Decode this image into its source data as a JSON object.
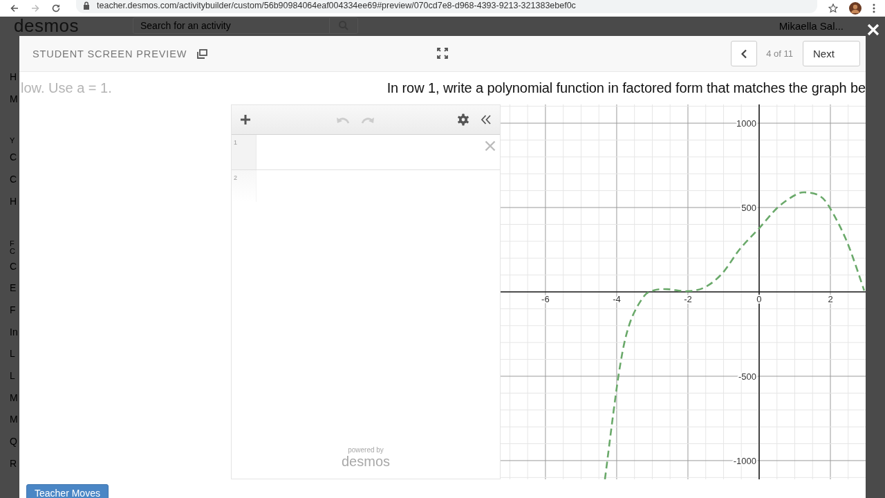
{
  "browser": {
    "url": "teacher.desmos.com/activitybuilder/custom/56b90984064eaf004334ee69#preview/070cd7e8-d968-4393-9213-321383ebef0c"
  },
  "background_page": {
    "logo": "desmos",
    "search": {
      "placeholder": "Search for an activity"
    },
    "user": "Mikaella Sal...",
    "sidebar_items": [
      {
        "label": "H",
        "kind": "item"
      },
      {
        "label": "M",
        "kind": "item"
      },
      {
        "label": "Y",
        "kind": "heading"
      },
      {
        "label": "C",
        "kind": "item"
      },
      {
        "label": "C",
        "kind": "item"
      },
      {
        "label": "H",
        "kind": "item"
      },
      {
        "label": "F",
        "kind": "heading"
      },
      {
        "label": "C",
        "kind": "subheading"
      },
      {
        "label": "C",
        "kind": "item"
      },
      {
        "label": "E",
        "kind": "item"
      },
      {
        "label": "F",
        "kind": "item"
      },
      {
        "label": "In",
        "kind": "item"
      },
      {
        "label": "L",
        "kind": "item"
      },
      {
        "label": "L",
        "kind": "item"
      },
      {
        "label": "M",
        "kind": "item"
      },
      {
        "label": "M",
        "kind": "item"
      },
      {
        "label": "Q",
        "kind": "item"
      },
      {
        "label": "R",
        "kind": "item"
      }
    ]
  },
  "modal": {
    "title": "STUDENT SCREEN PREVIEW",
    "pager": "4 of 11",
    "next_button": "Next",
    "prompt_faded": "low. Use a = 1.",
    "prompt": "In row 1, write a polynomial function in factored form that matches the graph be",
    "calculator": {
      "undo_enabled": false,
      "redo_enabled": false,
      "expressions": [
        {
          "number": "1",
          "selected": true
        },
        {
          "number": "2",
          "selected": false
        }
      ],
      "powered_by": "powered by",
      "brand": "desmos",
      "chart_data": {
        "type": "line",
        "x": [
          -4.33,
          -3.94,
          -3.65,
          -3.26,
          -2.97,
          -2.58,
          -2,
          -1.51,
          -1.03,
          -0.54,
          0,
          0.52,
          1.01,
          1.3,
          1.69,
          1.98,
          2.47,
          2.95
        ],
        "grid": true,
        "series": [
          {
            "color": "#6aa96a",
            "line_style": "dashed",
            "values": [
              -1111,
              -484,
              -197,
              -33,
              8,
              16,
              4,
              29,
              111,
              254,
              377,
              500,
              574,
              590,
              570,
              500,
              295,
              8
            ]
          }
        ],
        "xlim": [
          -7.26,
          2.99
        ],
        "ylim": [
          -1111,
          1111
        ],
        "xticks": [
          -6,
          -4,
          -2,
          0,
          2
        ],
        "yticks": [
          -1000,
          -500,
          500,
          1000
        ]
      }
    },
    "teacher_moves_button": "Teacher Moves"
  }
}
